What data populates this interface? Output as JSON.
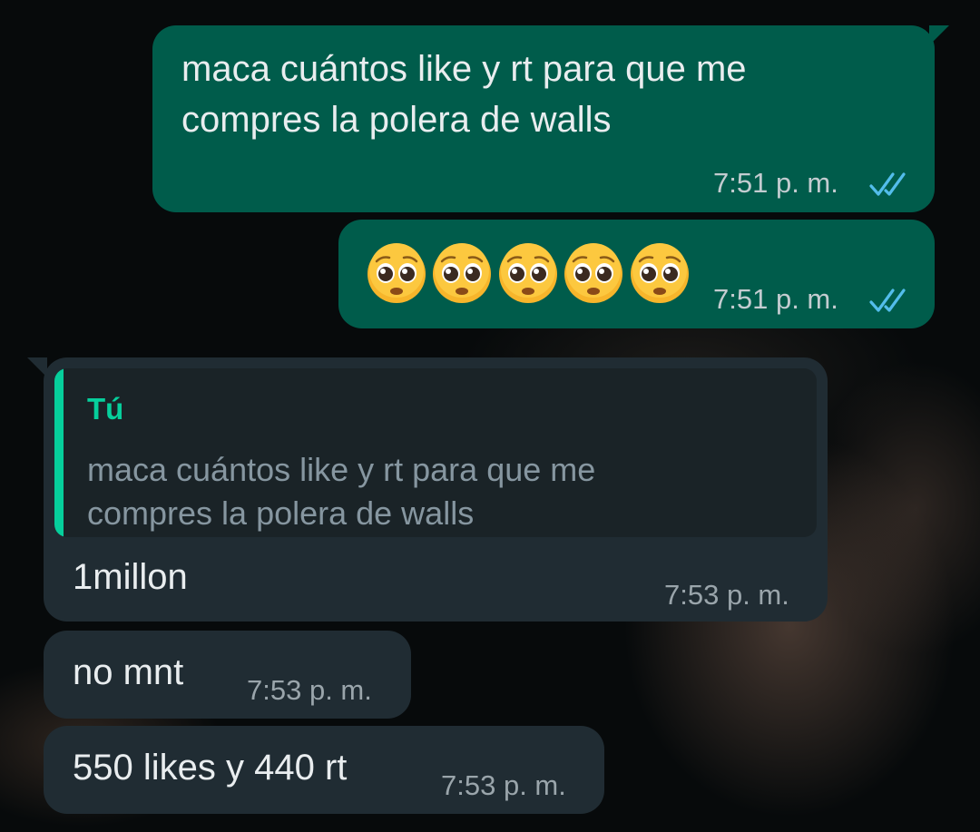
{
  "messages": [
    {
      "direction": "outgoing",
      "text": "maca cuántos like y rt para que me\ncompres la polera de walls",
      "time": "7:51 p. m.",
      "status": "read",
      "status_icon": "double-check-icon"
    },
    {
      "direction": "outgoing",
      "emojis": [
        "🥺",
        "🥺",
        "🥺",
        "🥺",
        "🥺"
      ],
      "time": "7:51 p. m.",
      "status": "read",
      "status_icon": "double-check-icon"
    },
    {
      "direction": "incoming",
      "quoted": {
        "author": "Tú",
        "text": "maca cuántos like y rt para que me\ncompres la polera de walls"
      },
      "text": "1millon",
      "time": "7:53 p. m."
    },
    {
      "direction": "incoming",
      "text": "no mnt",
      "time": "7:53 p. m."
    },
    {
      "direction": "incoming",
      "text": "550 likes y 440 rt",
      "time": "7:53 p. m."
    }
  ],
  "colors": {
    "outgoing_bubble": "#005c4b",
    "incoming_bubble": "#202c33",
    "quote_accent": "#06cf9c",
    "read_check": "#53bdeb",
    "background": "#070a0b"
  }
}
